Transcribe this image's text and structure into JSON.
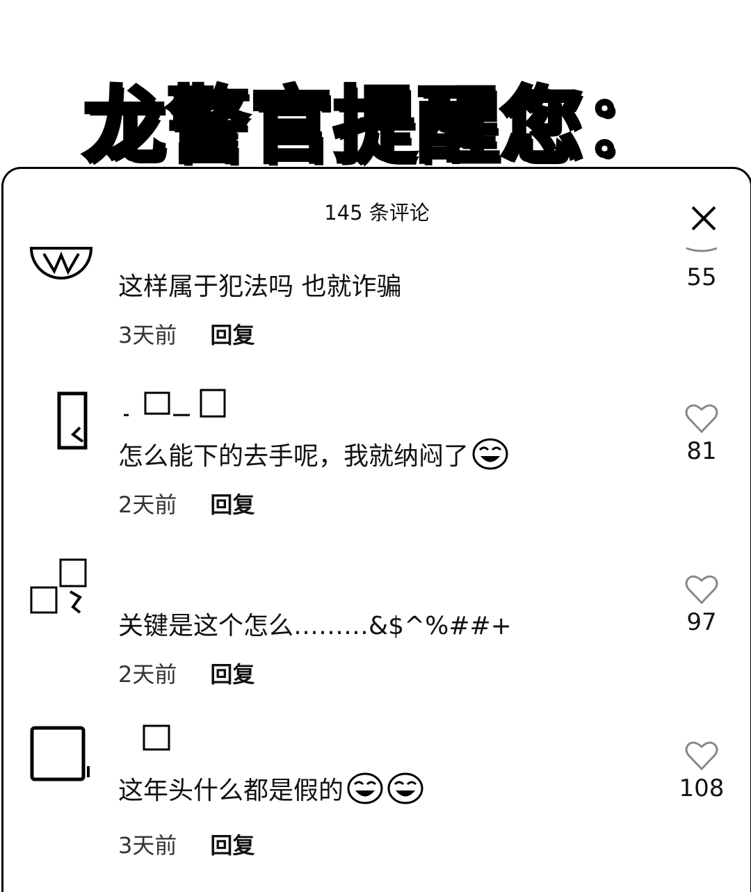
{
  "banner": {
    "title": "龙警官提醒您："
  },
  "sheet": {
    "header": "145 条评论"
  },
  "comments": [
    {
      "username": "",
      "text": "这样属于犯法吗 也就诈骗",
      "emojis": [],
      "time": "3天前",
      "reply": "回复",
      "likes": "55"
    },
    {
      "username": "",
      "text": "怎么能下的去手呢，我就纳闷了",
      "emojis": [
        "laugh-cry-emoji"
      ],
      "time": "2天前",
      "reply": "回复",
      "likes": "81"
    },
    {
      "username": "",
      "text": "关键是这个怎么………&$^%##+",
      "emojis": [],
      "time": "2天前",
      "reply": "回复",
      "likes": "97"
    },
    {
      "username": "",
      "text": "这年头什么都是假的",
      "emojis": [
        "laugh-cry-emoji",
        "laugh-cry-emoji"
      ],
      "time": "3天前",
      "reply": "回复",
      "likes": "108"
    }
  ],
  "icons": {
    "close": "close-icon",
    "like": "heart-outline-icon"
  },
  "colors": {
    "text": "#111111",
    "background": "#ffffff"
  }
}
